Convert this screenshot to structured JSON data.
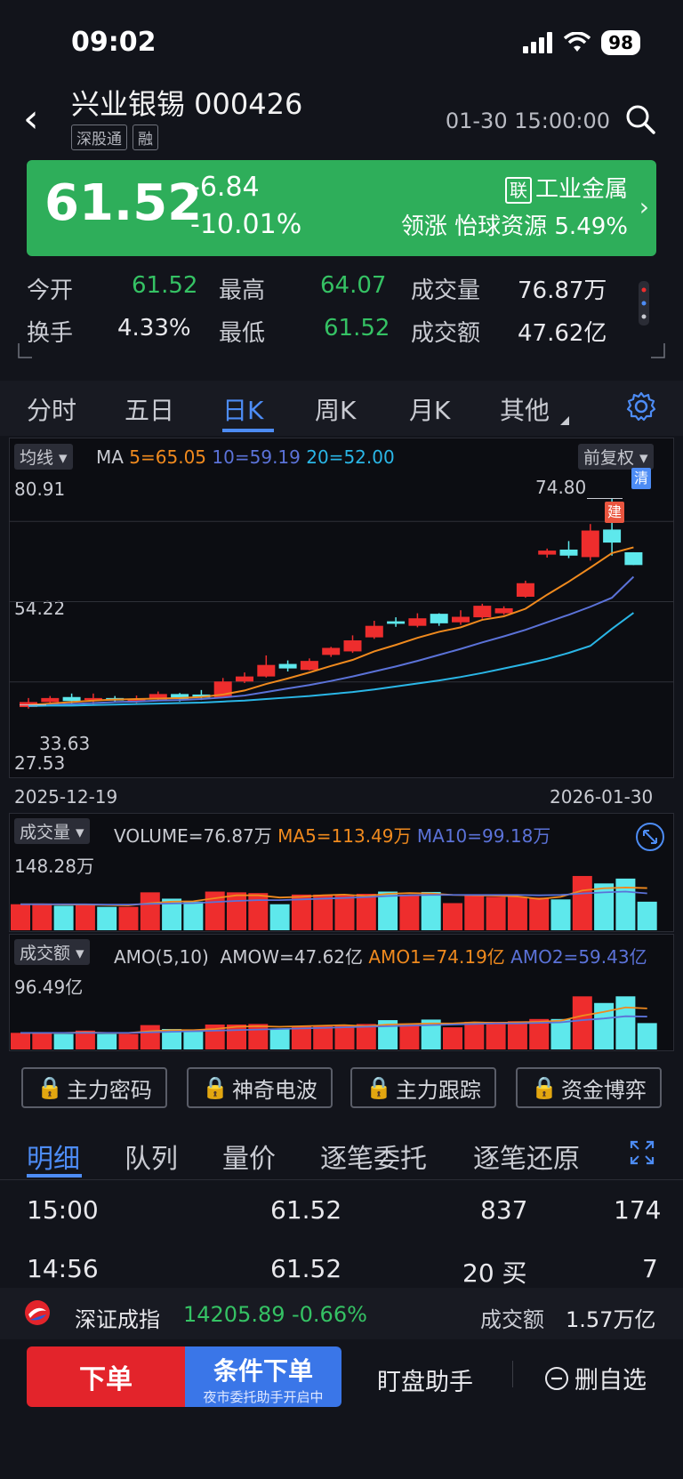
{
  "status": {
    "time": "09:02",
    "battery": "98"
  },
  "header": {
    "title": "兴业银锡 000426",
    "tags": [
      "深股通",
      "融"
    ],
    "datetime": "01-30 15:00:00"
  },
  "banner": {
    "price": "61.52",
    "change": "-6.84",
    "change_pct": "-10.01%",
    "sector_badge": "联",
    "sector": "工业金属",
    "leader": "领涨 怡球资源 5.49%"
  },
  "stats": [
    {
      "label": "今开",
      "value": "61.52"
    },
    {
      "label": "最高",
      "value": "64.07"
    },
    {
      "label": "成交量",
      "value": "76.87万"
    },
    {
      "label": "换手",
      "value": "4.33%"
    },
    {
      "label": "最低",
      "value": "61.52"
    },
    {
      "label": "成交额",
      "value": "47.62亿"
    }
  ],
  "ktabs": [
    "分时",
    "五日",
    "日K",
    "周K",
    "月K",
    "其他"
  ],
  "main_chart": {
    "ma_chip": "均线",
    "ma_label": "MA",
    "ma5": "5=65.05",
    "ma10": "10=59.19",
    "ma20": "20=52.00",
    "adjust_chip": "前复权",
    "y_top": "80.91",
    "y_mid": "54.22",
    "y_bottom": "27.53",
    "high_marker": "74.80",
    "low_marker": "33.63",
    "tag_clear": "清",
    "tag_build": "建",
    "date_start": "2025-12-19",
    "date_end": "2026-01-30"
  },
  "volume_chart": {
    "chip": "成交量",
    "label": "VOLUME=76.87万",
    "ma5": "MA5=113.49万",
    "ma10": "MA10=99.18万",
    "y_top": "148.28万"
  },
  "amount_chart": {
    "chip": "成交额",
    "label": "AMO(5,10)",
    "amow": "AMOW=47.62亿",
    "amo1": "AMO1=74.19亿",
    "amo2": "AMO2=59.43亿",
    "y_top": "96.49亿"
  },
  "tools": [
    "主力密码",
    "神奇电波",
    "主力跟踪",
    "资金博弈"
  ],
  "detail_tabs": [
    "明细",
    "队列",
    "量价",
    "逐笔委托",
    "逐笔还原"
  ],
  "trades": [
    {
      "time": "15:00",
      "price": "61.52",
      "vol": "837",
      "count": "174"
    },
    {
      "time": "14:56",
      "price": "61.52",
      "vol": "20 买",
      "count": "7"
    }
  ],
  "index_bar": {
    "name": "深证成指",
    "value": "14205.89",
    "change": "-0.66%",
    "amount_label": "成交额",
    "amount": "1.57万亿"
  },
  "bottom": {
    "order": "下单",
    "cond": "条件下单",
    "cond_sub": "夜市委托助手开启中",
    "watch": "盯盘助手",
    "remove": "删自选"
  },
  "colors": {
    "up": "#ee2d2d",
    "down": "#35c264",
    "hollow_down": "#5ee8ec",
    "accent": "#4d8cf5"
  },
  "chart_data": [
    {
      "type": "candlestick",
      "title": "",
      "y_range": [
        27.53,
        80.91
      ],
      "x_range": [
        "2025-12-19",
        "2026-01-30"
      ],
      "candles": [
        {
          "o": 33.2,
          "h": 35.0,
          "l": 32.9,
          "c": 34.2
        },
        {
          "o": 34.2,
          "h": 35.4,
          "l": 33.9,
          "c": 35.0
        },
        {
          "o": 35.2,
          "h": 35.9,
          "l": 33.9,
          "c": 34.4
        },
        {
          "o": 34.6,
          "h": 35.9,
          "l": 33.7,
          "c": 35.0
        },
        {
          "o": 35.0,
          "h": 35.4,
          "l": 34.1,
          "c": 34.5
        },
        {
          "o": 34.6,
          "h": 35.5,
          "l": 34.0,
          "c": 34.7
        },
        {
          "o": 34.7,
          "h": 36.3,
          "l": 34.5,
          "c": 35.8
        },
        {
          "o": 35.8,
          "h": 36.0,
          "l": 34.3,
          "c": 34.8
        },
        {
          "o": 35.7,
          "h": 36.6,
          "l": 34.6,
          "c": 35.1
        },
        {
          "o": 35.1,
          "h": 39.0,
          "l": 35.0,
          "c": 38.3
        },
        {
          "o": 38.3,
          "h": 40.1,
          "l": 38.0,
          "c": 39.3
        },
        {
          "o": 39.3,
          "h": 43.5,
          "l": 39.1,
          "c": 41.6
        },
        {
          "o": 41.8,
          "h": 42.5,
          "l": 40.3,
          "c": 40.9
        },
        {
          "o": 40.6,
          "h": 42.9,
          "l": 40.5,
          "c": 42.4
        },
        {
          "o": 43.6,
          "h": 45.2,
          "l": 43.2,
          "c": 45.0
        },
        {
          "o": 44.3,
          "h": 47.5,
          "l": 44.0,
          "c": 46.5
        },
        {
          "o": 47.1,
          "h": 50.4,
          "l": 46.8,
          "c": 49.4
        },
        {
          "o": 50.3,
          "h": 51.1,
          "l": 49.2,
          "c": 49.8
        },
        {
          "o": 49.4,
          "h": 51.9,
          "l": 49.1,
          "c": 50.9
        },
        {
          "o": 51.8,
          "h": 51.9,
          "l": 49.4,
          "c": 49.9
        },
        {
          "o": 50.1,
          "h": 52.5,
          "l": 49.6,
          "c": 51.2
        },
        {
          "o": 51.1,
          "h": 53.8,
          "l": 50.8,
          "c": 53.4
        },
        {
          "o": 51.9,
          "h": 53.3,
          "l": 51.6,
          "c": 52.9
        },
        {
          "o": 55.2,
          "h": 58.4,
          "l": 55.0,
          "c": 57.9
        },
        {
          "o": 63.6,
          "h": 64.8,
          "l": 63.0,
          "c": 64.4
        },
        {
          "o": 64.6,
          "h": 66.3,
          "l": 62.9,
          "c": 63.4
        },
        {
          "o": 63.1,
          "h": 69.7,
          "l": 62.4,
          "c": 68.4
        },
        {
          "o": 68.6,
          "h": 74.8,
          "l": 63.4,
          "c": 66.0
        },
        {
          "o": 64.07,
          "h": 64.07,
          "l": 61.52,
          "c": 61.52
        }
      ],
      "ma5": [
        33.6,
        33.9,
        34.2,
        34.5,
        34.7,
        34.8,
        34.9,
        35.0,
        35.2,
        35.7,
        36.5,
        37.8,
        38.9,
        40.1,
        41.4,
        42.6,
        44.3,
        45.6,
        47.0,
        48.2,
        49.1,
        50.6,
        51.3,
        52.8,
        55.6,
        58.2,
        61.0,
        63.9,
        65.05
      ],
      "ma10": [
        33.5,
        33.6,
        33.8,
        34.0,
        34.2,
        34.3,
        34.5,
        34.6,
        34.8,
        35.1,
        35.5,
        36.2,
        36.9,
        37.6,
        38.4,
        39.3,
        40.3,
        41.3,
        42.4,
        43.6,
        44.8,
        46.1,
        47.3,
        48.6,
        50.1,
        51.6,
        53.2,
        55.0,
        59.19
      ],
      "ma20": [
        33.4,
        33.5,
        33.5,
        33.6,
        33.7,
        33.8,
        33.9,
        34.0,
        34.1,
        34.3,
        34.5,
        34.8,
        35.1,
        35.4,
        35.8,
        36.2,
        36.7,
        37.3,
        37.9,
        38.5,
        39.2,
        40.0,
        40.9,
        41.8,
        42.8,
        44.0,
        45.4,
        48.8,
        52.0
      ]
    },
    {
      "type": "bar",
      "title": "",
      "unit": "万",
      "y_max": 148.28,
      "values": [
        70,
        72,
        66,
        70,
        63,
        63,
        102,
        85,
        77,
        104,
        102,
        100,
        70,
        96,
        96,
        94,
        98,
        104,
        96,
        103,
        73,
        96,
        90,
        90,
        88,
        83,
        146,
        126,
        139,
        76.87
      ],
      "ma5": [
        70,
        70,
        69,
        69,
        68,
        67,
        73,
        77,
        78,
        86,
        94,
        94,
        88,
        90,
        94,
        96,
        92,
        98,
        100,
        99,
        95,
        94,
        93,
        91,
        84,
        90,
        107,
        113,
        115,
        113.49
      ],
      "ma10": [
        70,
        70,
        70,
        70,
        69,
        69,
        71,
        72,
        73,
        76,
        79,
        81,
        81,
        83,
        85,
        87,
        89,
        92,
        94,
        95,
        95,
        95,
        95,
        95,
        94,
        95,
        99,
        102,
        104,
        99.18
      ]
    },
    {
      "type": "bar",
      "title": "",
      "unit": "亿",
      "y_max": 96.49,
      "values": [
        30,
        31,
        28,
        34,
        28,
        28,
        44,
        37,
        32,
        45,
        45,
        46,
        37,
        42,
        42,
        43,
        46,
        53,
        47,
        54,
        40,
        50,
        50,
        51,
        55,
        55,
        96,
        84,
        96,
        47.62
      ],
      "ma5": [
        30,
        30,
        30,
        31,
        30,
        30,
        33,
        35,
        35,
        37,
        41,
        42,
        41,
        42,
        43,
        44,
        42,
        45,
        46,
        47,
        47,
        49,
        48,
        49,
        50,
        52,
        61,
        68,
        76,
        74.19
      ],
      "ma10": [
        30,
        30,
        30,
        30,
        30,
        30,
        31,
        32,
        33,
        34,
        35,
        36,
        37,
        38,
        39,
        40,
        41,
        42,
        43,
        44,
        45,
        46,
        47,
        47,
        48,
        49,
        53,
        56,
        60,
        59.43
      ]
    }
  ]
}
